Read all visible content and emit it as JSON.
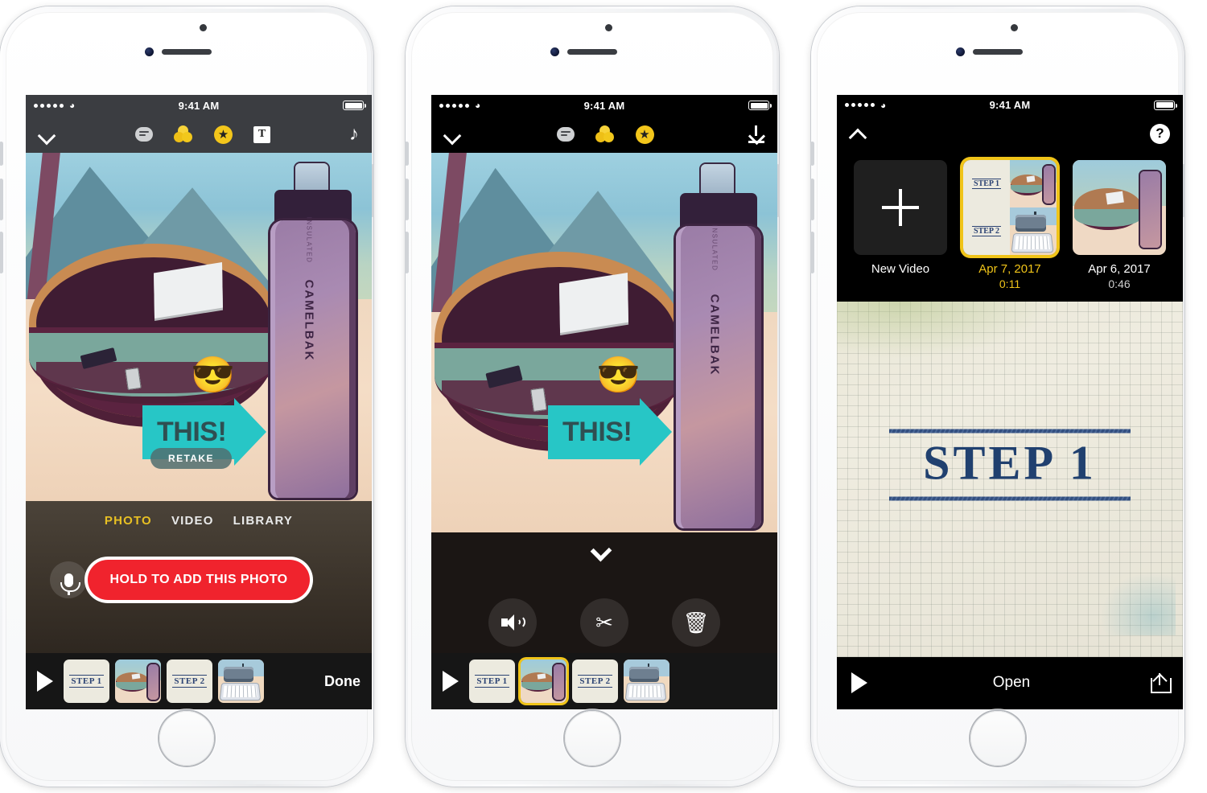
{
  "phones": [
    {
      "id": "phone-capture",
      "status": {
        "time": "9:41 AM",
        "signal_dots": 5,
        "wifi_icon": "wifi-icon",
        "battery_icon": "battery-icon"
      },
      "toolbar": {
        "left_icon": "chevron-down-icon",
        "items": [
          "speech-bubble-icon",
          "three-circles-icon",
          "star-badge-icon",
          "text-tool-icon"
        ],
        "right_icon": "music-note-icon",
        "right_glyph": "♪"
      },
      "photo": {
        "bottle_label": "CAMELBAK",
        "bottle_sublabel": "INSULATED",
        "emoji": "😎",
        "sticker_text": "THIS!",
        "retake_label": "RETAKE"
      },
      "camera": {
        "modes": [
          {
            "label": "PHOTO",
            "active": true
          },
          {
            "label": "VIDEO",
            "active": false
          },
          {
            "label": "LIBRARY",
            "active": false
          }
        ],
        "mic_icon": "microphone-icon",
        "shutter_label": "HOLD TO ADD THIS PHOTO"
      },
      "filmstrip": {
        "play_icon": "play-icon",
        "clips": [
          {
            "type": "step",
            "label": "STEP 1",
            "selected": false
          },
          {
            "type": "photo",
            "label": "",
            "selected": false
          },
          {
            "type": "step",
            "label": "STEP 2",
            "selected": false
          },
          {
            "type": "typewriter",
            "label": "",
            "selected": false
          }
        ],
        "done_label": "Done"
      }
    },
    {
      "id": "phone-edit",
      "status": {
        "time": "9:41 AM",
        "signal_dots": 5,
        "wifi_icon": "wifi-icon",
        "battery_icon": "battery-icon"
      },
      "toolbar": {
        "left_icon": "chevron-down-icon",
        "items": [
          "speech-bubble-icon",
          "three-circles-icon",
          "star-badge-icon"
        ],
        "right_icon": "download-icon"
      },
      "photo": {
        "bottle_label": "CAMELBAK",
        "bottle_sublabel": "INSULATED",
        "emoji": "😎",
        "sticker_text": "THIS!"
      },
      "edit": {
        "handle_icon": "chevron-down-handle-icon",
        "buttons": [
          {
            "icon": "volume-icon",
            "name": "volume-button"
          },
          {
            "icon": "scissors-icon",
            "name": "trim-button",
            "glyph": "✂"
          },
          {
            "icon": "trash-icon",
            "name": "delete-button",
            "glyph": "🗑"
          }
        ]
      },
      "filmstrip": {
        "play_icon": "play-icon",
        "clips": [
          {
            "type": "step",
            "label": "STEP 1",
            "selected": false
          },
          {
            "type": "photo",
            "label": "",
            "selected": true
          },
          {
            "type": "step",
            "label": "STEP 2",
            "selected": false
          },
          {
            "type": "typewriter",
            "label": "",
            "selected": false
          }
        ]
      }
    },
    {
      "id": "phone-library",
      "status": {
        "time": "9:41 AM",
        "signal_dots": 5,
        "wifi_icon": "wifi-icon",
        "battery_icon": "battery-icon"
      },
      "toolbar": {
        "left_icon": "chevron-up-icon",
        "right_icon": "help-icon",
        "help_glyph": "?"
      },
      "library": {
        "items": [
          {
            "kind": "new",
            "label": "New Video",
            "duration": "",
            "selected": false,
            "plus_icon": "plus-icon"
          },
          {
            "kind": "collage",
            "label": "Apr 7, 2017",
            "duration": "0:11",
            "selected": true,
            "step_labels": [
              "STEP 1",
              "STEP 2"
            ]
          },
          {
            "kind": "photo",
            "label": "Apr 6, 2017",
            "duration": "0:46",
            "selected": false
          }
        ]
      },
      "slide": {
        "title": "STEP 1"
      },
      "bottombar": {
        "play_icon": "play-icon",
        "label": "Open",
        "share_icon": "share-icon"
      }
    }
  ]
}
